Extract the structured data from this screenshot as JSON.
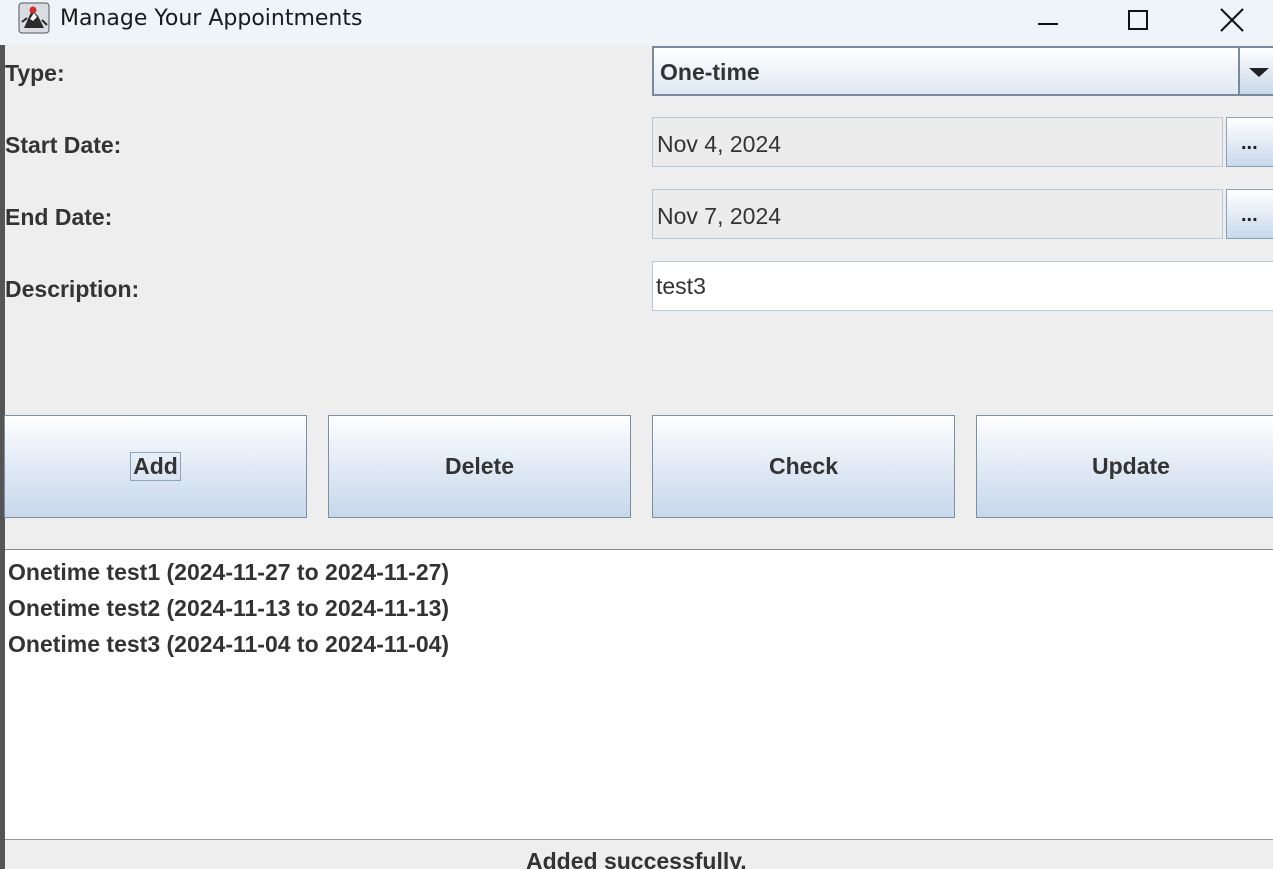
{
  "window": {
    "title": "Manage Your Appointments",
    "icons": [
      "java-duke-icon",
      "minimize-icon",
      "maximize-icon",
      "close-icon"
    ]
  },
  "form": {
    "type_label": "Type:",
    "type_value": "One-time",
    "start_label": "Start Date:",
    "start_value": "Nov 4, 2024",
    "end_label": "End Date:",
    "end_value": "Nov 7, 2024",
    "description_label": "Description:",
    "description_value": "test3",
    "date_picker_label": "..."
  },
  "buttons": {
    "add": "Add",
    "delete": "Delete",
    "check": "Check",
    "update": "Update"
  },
  "appointments": [
    "Onetime test1 (2024-11-27 to 2024-11-27)",
    "Onetime test2 (2024-11-13 to 2024-11-13)",
    "Onetime test3 (2024-11-04 to 2024-11-04)"
  ],
  "status": "Added successfully.",
  "colors": {
    "titlebar": "#eff4f9",
    "background": "#eeeeee",
    "button_gradient_bottom": "#c7d7ea",
    "text": "#333333"
  }
}
